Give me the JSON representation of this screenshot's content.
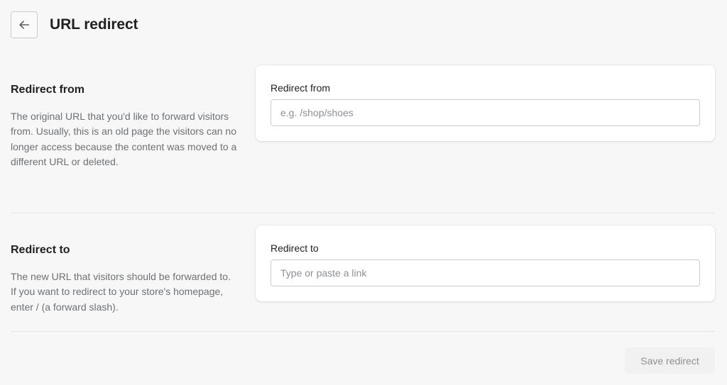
{
  "header": {
    "title": "URL redirect",
    "back_icon": "arrow-left-icon"
  },
  "redirect_from": {
    "title": "Redirect from",
    "description": "The original URL that you'd like to forward visitors from. Usually, this is an old page the visitors can no longer access because the content was moved to a different URL or deleted.",
    "field_label": "Redirect from",
    "value": "",
    "placeholder": "e.g. /shop/shoes"
  },
  "redirect_to": {
    "title": "Redirect to",
    "description": "The new URL that visitors should be forwarded to. If you want to redirect to your store's homepage, enter / (a forward slash).",
    "field_label": "Redirect to",
    "value": "",
    "placeholder": "Type or paste a link"
  },
  "actions": {
    "save_label": "Save redirect",
    "save_disabled": true
  },
  "colors": {
    "background": "#f7f7f7",
    "card": "#ffffff",
    "text_primary": "#202223",
    "text_secondary": "#6d7175",
    "placeholder": "#8c9196",
    "border": "#c9cccf",
    "button_disabled_bg": "#f1f1f1",
    "button_disabled_text": "#8c9196"
  }
}
